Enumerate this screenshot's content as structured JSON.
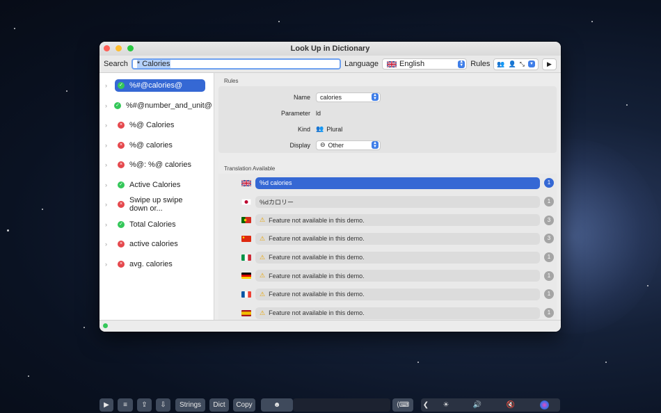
{
  "window": {
    "title": "Look Up in Dictionary"
  },
  "toolbar": {
    "search_label": "Search",
    "search_value": "* Calories",
    "language_label": "Language",
    "language_value": "English",
    "rules_label": "Rules"
  },
  "sidebar": {
    "items": [
      {
        "label": "%#@calories@",
        "status": "ok",
        "selected": true
      },
      {
        "label": "%#@number_and_unit@",
        "status": "ok"
      },
      {
        "label": "%@ Calories",
        "status": "err"
      },
      {
        "label": "%@ calories",
        "status": "err"
      },
      {
        "label": "%@: %@ calories",
        "status": "err"
      },
      {
        "label": "Active Calories",
        "status": "ok"
      },
      {
        "label": "Swipe up swipe down or...",
        "status": "err"
      },
      {
        "label": "Total Calories",
        "status": "ok"
      },
      {
        "label": "active calories",
        "status": "err"
      },
      {
        "label": "avg. calories",
        "status": "err"
      }
    ]
  },
  "rules": {
    "section_title": "Rules",
    "name_label": "Name",
    "name_value": "calories",
    "parameter_label": "Parameter",
    "parameter_value": "ld",
    "kind_label": "Kind",
    "kind_value": "Plural",
    "display_label": "Display",
    "display_value": "Other"
  },
  "translations": {
    "section_title": "Translation Available",
    "rows": [
      {
        "flag": "uk",
        "text": "%d calories",
        "count": "1",
        "selected": true,
        "warn": false
      },
      {
        "flag": "jp",
        "text": "%dカロリー",
        "count": "1",
        "warn": false
      },
      {
        "flag": "pt",
        "text": "Feature not available in this demo.",
        "count": "3",
        "warn": true
      },
      {
        "flag": "cn",
        "text": "Feature not available in this demo.",
        "count": "3",
        "warn": true
      },
      {
        "flag": "it",
        "text": "Feature not available in this demo.",
        "count": "1",
        "warn": true
      },
      {
        "flag": "de",
        "text": "Feature not available in this demo.",
        "count": "1",
        "warn": true
      },
      {
        "flag": "fr",
        "text": "Feature not available in this demo.",
        "count": "1",
        "warn": true
      },
      {
        "flag": "es",
        "text": "Feature not available in this demo.",
        "count": "1",
        "warn": true
      }
    ]
  },
  "touchbar": {
    "strings": "Strings",
    "dict": "Dict",
    "copy": "Copy"
  },
  "colors": {
    "accent": "#3568d4",
    "ok": "#34c759",
    "error": "#e5484d"
  }
}
